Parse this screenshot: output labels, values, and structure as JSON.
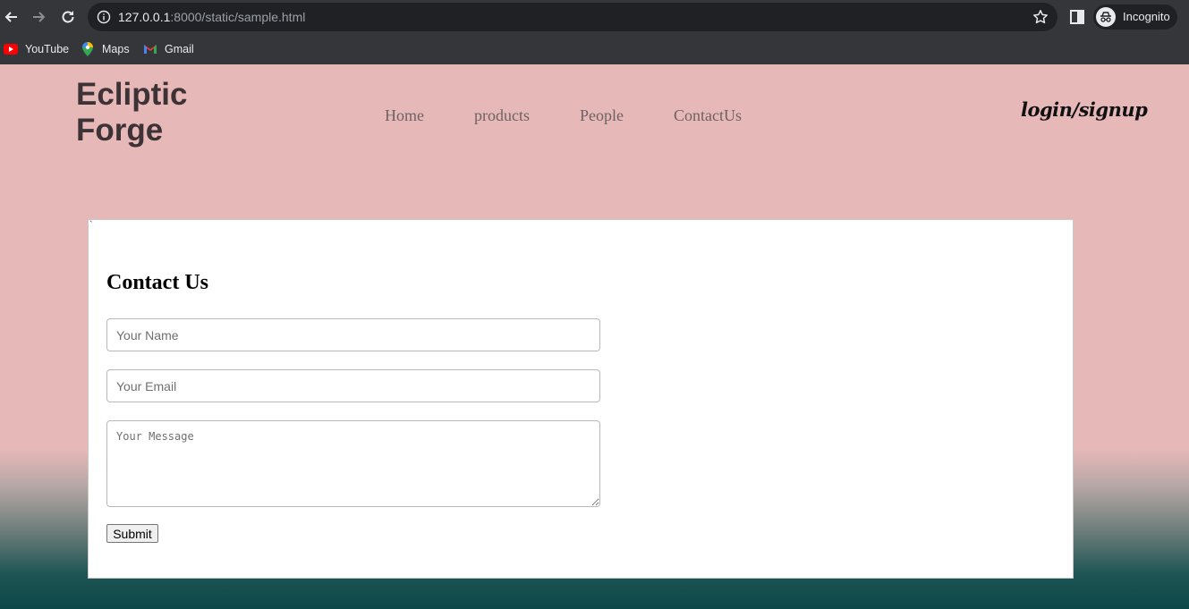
{
  "browser": {
    "url_host": "127.0.0.1",
    "url_rest": ":8000/static/sample.html",
    "profile_label": "Incognito",
    "icons": {
      "back": "back-arrow-icon",
      "forward": "forward-arrow-icon",
      "reload": "reload-icon",
      "info": "info-icon",
      "bookmark": "star-icon",
      "side_panel": "side-panel-icon",
      "incognito": "incognito-icon"
    },
    "bookmarks": [
      {
        "label": "YouTube",
        "icon": "youtube-icon",
        "color": "#ff0000"
      },
      {
        "label": "Maps",
        "icon": "maps-pin-icon",
        "color": "#34a853"
      },
      {
        "label": "Gmail",
        "icon": "gmail-icon",
        "color": "#ea4335"
      }
    ]
  },
  "site": {
    "brand_line1": "Ecliptic",
    "brand_line2": "Forge",
    "nav": [
      "Home",
      "products",
      "People",
      "ContactUs"
    ],
    "login_label": "login/signup",
    "colors": {
      "background": "#e7b8b8",
      "brand": "#3d3336",
      "nav": "#6e6262"
    }
  },
  "contact": {
    "stray_mark": "`",
    "heading": "Contact Us",
    "name_placeholder": "Your Name",
    "email_placeholder": "Your Email",
    "message_placeholder": "Your Message",
    "submit_label": "Submit"
  }
}
